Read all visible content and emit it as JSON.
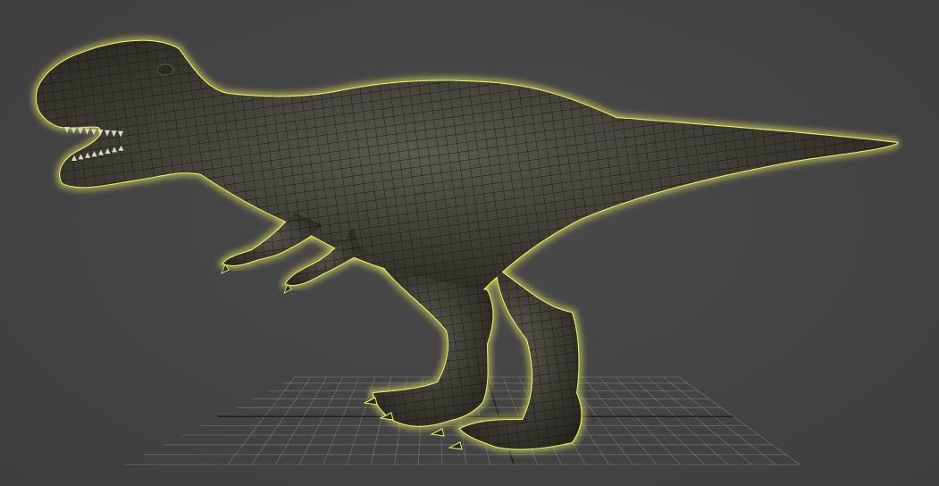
{
  "viewport": {
    "background_color": "#444444",
    "selection_highlight_color": "#e8f060",
    "mesh_color": "#3a3a34",
    "wire_color": "#15150f",
    "grid_color": "#8a8a8a",
    "grid_axis_color": "#1e1e1e"
  },
  "scene": {
    "object": "t-rex-model",
    "display_mode": "wireframe-on-shaded",
    "selected": true,
    "ground_grid_visible": true
  }
}
